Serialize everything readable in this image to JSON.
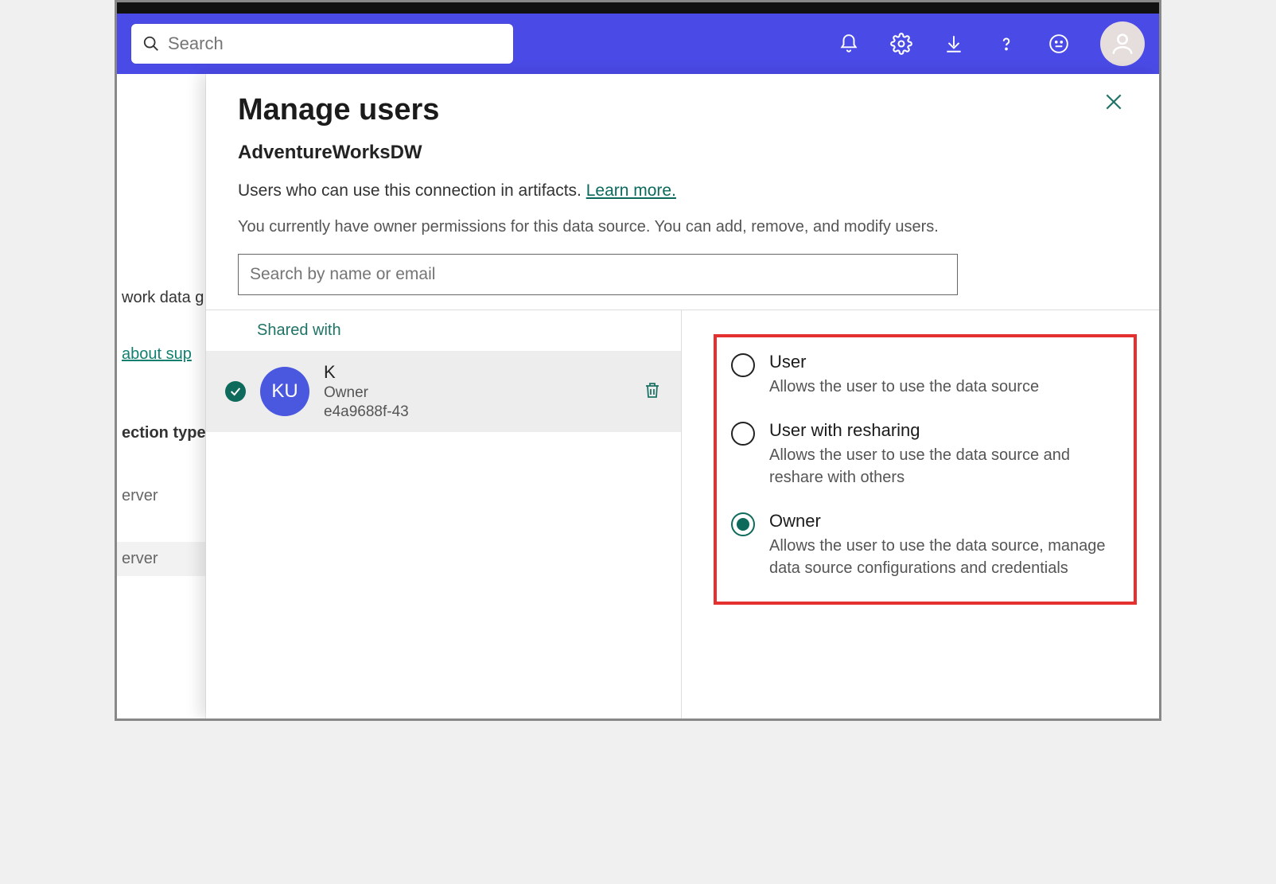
{
  "topbar": {
    "search_placeholder": "Search"
  },
  "behind": {
    "peek1": "work data g",
    "peek2": "about sup",
    "peek3": "ection type",
    "peek4": "erver",
    "peek5": "erver"
  },
  "panel": {
    "title": "Manage users",
    "subtitle": "AdventureWorksDW",
    "description_text": "Users who can use this connection in artifacts. ",
    "learn_more": "Learn more.",
    "note": "You currently have owner permissions for this data source. You can add, remove, and modify users.",
    "search_placeholder": "Search by name or email",
    "shared_with_label": "Shared with"
  },
  "user": {
    "initials": "KU",
    "name": "K",
    "role": "Owner",
    "id": "e4a9688f-43"
  },
  "roles": [
    {
      "label": "User",
      "desc": "Allows the user to use the data source",
      "selected": false
    },
    {
      "label": "User with resharing",
      "desc": "Allows the user to use the data source and reshare with others",
      "selected": false
    },
    {
      "label": "Owner",
      "desc": "Allows the user to use the data source, manage data source configurations and credentials",
      "selected": true
    }
  ]
}
